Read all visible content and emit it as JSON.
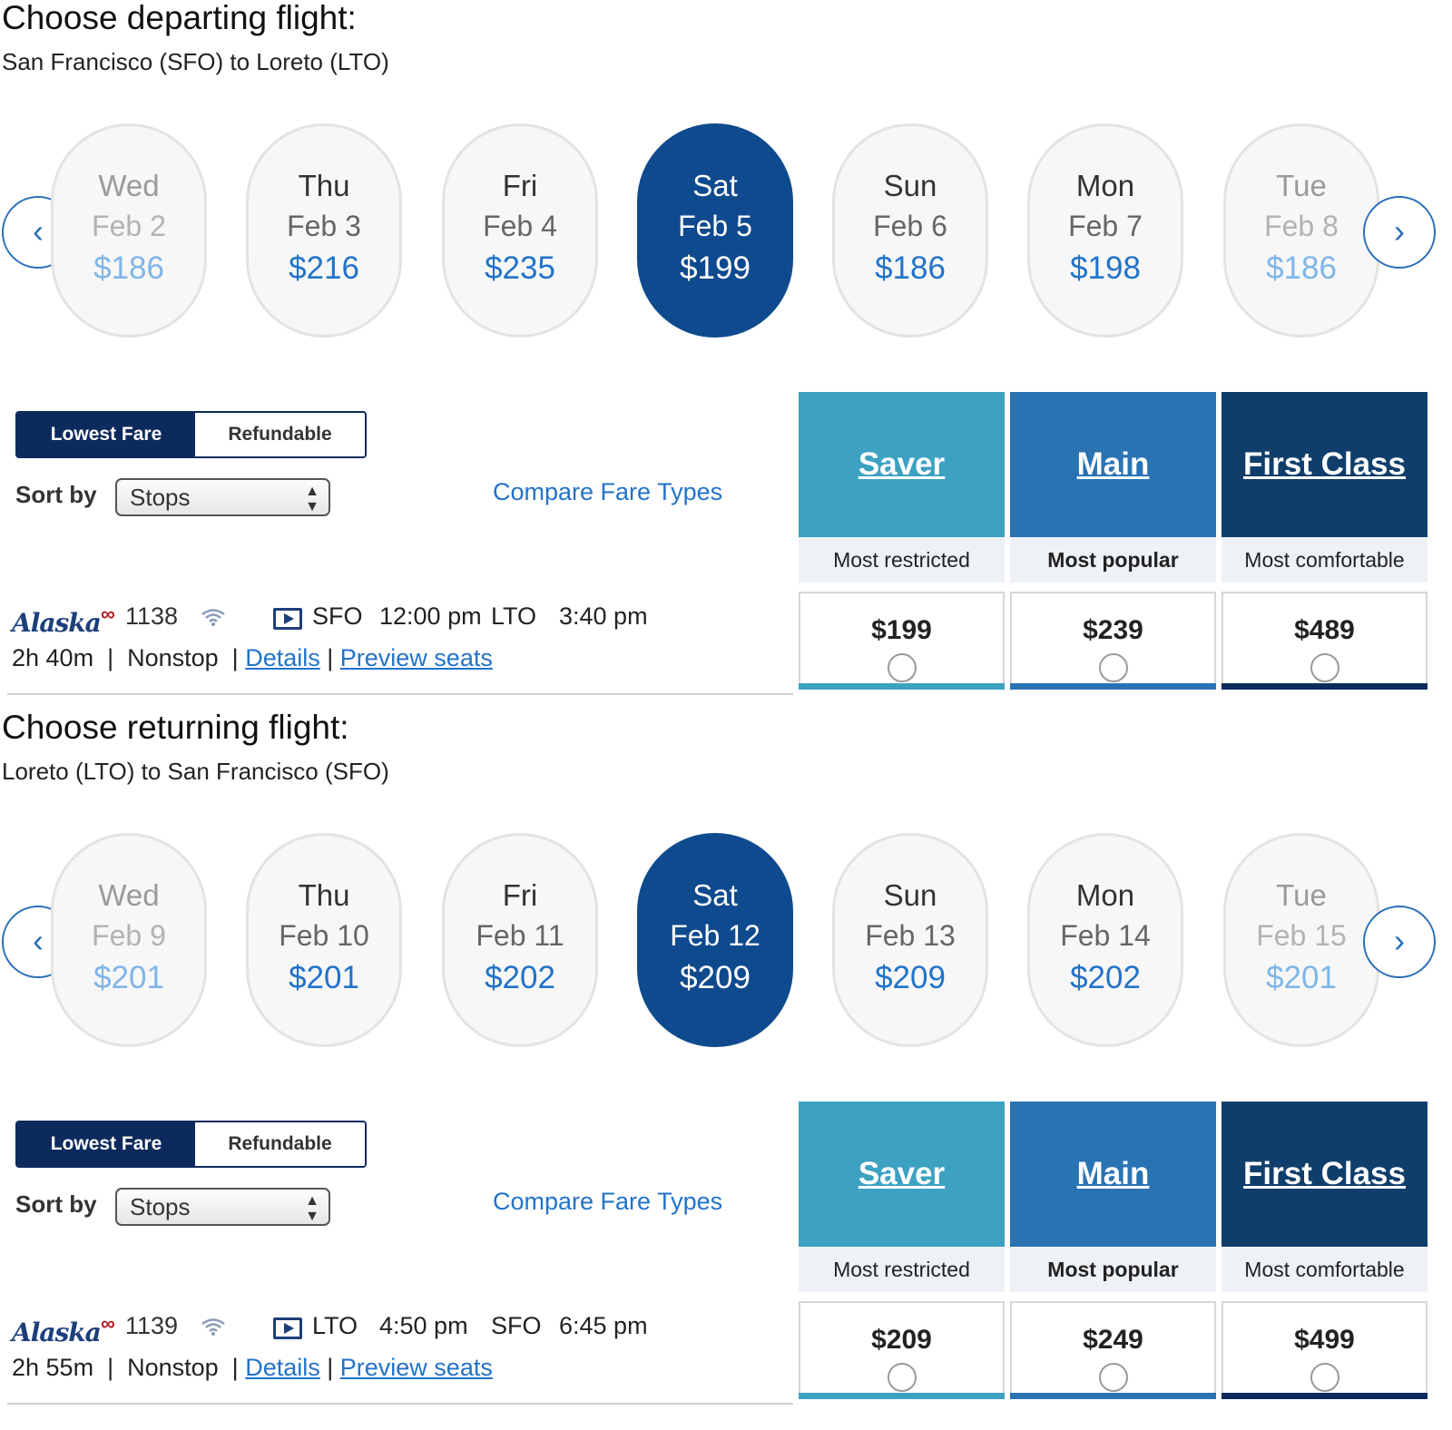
{
  "departing": {
    "title": "Choose departing flight:",
    "route": "San Francisco (SFO) to Loreto (LTO)",
    "dates": [
      {
        "dow": "Wed",
        "date": "Feb 2",
        "price": "$186"
      },
      {
        "dow": "Thu",
        "date": "Feb 3",
        "price": "$216"
      },
      {
        "dow": "Fri",
        "date": "Feb 4",
        "price": "$235"
      },
      {
        "dow": "Sat",
        "date": "Feb 5",
        "price": "$199"
      },
      {
        "dow": "Sun",
        "date": "Feb 6",
        "price": "$186"
      },
      {
        "dow": "Mon",
        "date": "Feb 7",
        "price": "$198"
      },
      {
        "dow": "Tue",
        "date": "Feb 8",
        "price": "$186"
      }
    ],
    "toggle": {
      "lowest": "Lowest Fare",
      "refundable": "Refundable"
    },
    "sort_label": "Sort by",
    "sort_value": "Stops",
    "compare": "Compare Fare Types",
    "fares": [
      {
        "name": "Saver",
        "desc": "Most restricted",
        "price": "$199"
      },
      {
        "name": "Main",
        "desc": "Most popular",
        "price": "$239"
      },
      {
        "name": "First Class",
        "desc": "Most comfortable",
        "price": "$489"
      }
    ],
    "flight": {
      "airline": "Alaska",
      "codeshare": "∞",
      "number": "1138",
      "from": "SFO",
      "depart": "12:00 pm",
      "to": "LTO",
      "arrive": "3:40 pm",
      "duration": "2h 40m",
      "stops": "Nonstop",
      "details": "Details",
      "preview": "Preview seats"
    }
  },
  "returning": {
    "title": "Choose returning flight:",
    "route": "Loreto (LTO) to San Francisco (SFO)",
    "dates": [
      {
        "dow": "Wed",
        "date": "Feb 9",
        "price": "$201"
      },
      {
        "dow": "Thu",
        "date": "Feb 10",
        "price": "$201"
      },
      {
        "dow": "Fri",
        "date": "Feb 11",
        "price": "$202"
      },
      {
        "dow": "Sat",
        "date": "Feb 12",
        "price": "$209"
      },
      {
        "dow": "Sun",
        "date": "Feb 13",
        "price": "$209"
      },
      {
        "dow": "Mon",
        "date": "Feb 14",
        "price": "$202"
      },
      {
        "dow": "Tue",
        "date": "Feb 15",
        "price": "$201"
      }
    ],
    "toggle": {
      "lowest": "Lowest Fare",
      "refundable": "Refundable"
    },
    "sort_label": "Sort by",
    "sort_value": "Stops",
    "compare": "Compare Fare Types",
    "fares": [
      {
        "name": "Saver",
        "desc": "Most restricted",
        "price": "$209"
      },
      {
        "name": "Main",
        "desc": "Most popular",
        "price": "$249"
      },
      {
        "name": "First Class",
        "desc": "Most comfortable",
        "price": "$499"
      }
    ],
    "flight": {
      "airline": "Alaska",
      "codeshare": "∞",
      "number": "1139",
      "from": "LTO",
      "depart": "4:50 pm",
      "to": "SFO",
      "arrive": "6:45 pm",
      "duration": "2h 55m",
      "stops": "Nonstop",
      "details": "Details",
      "preview": "Preview seats"
    }
  },
  "icons": {
    "prev": "chevron-left-icon",
    "next": "chevron-right-icon",
    "wifi": "wifi-icon",
    "video": "video-icon"
  },
  "colors": {
    "selected_date": "#0f4a8e",
    "price_blue": "#2273c9",
    "saver": "#3da1c2",
    "main": "#2a73b3",
    "first": "#0f3e6b",
    "toggle_active": "#0d2a5c"
  }
}
